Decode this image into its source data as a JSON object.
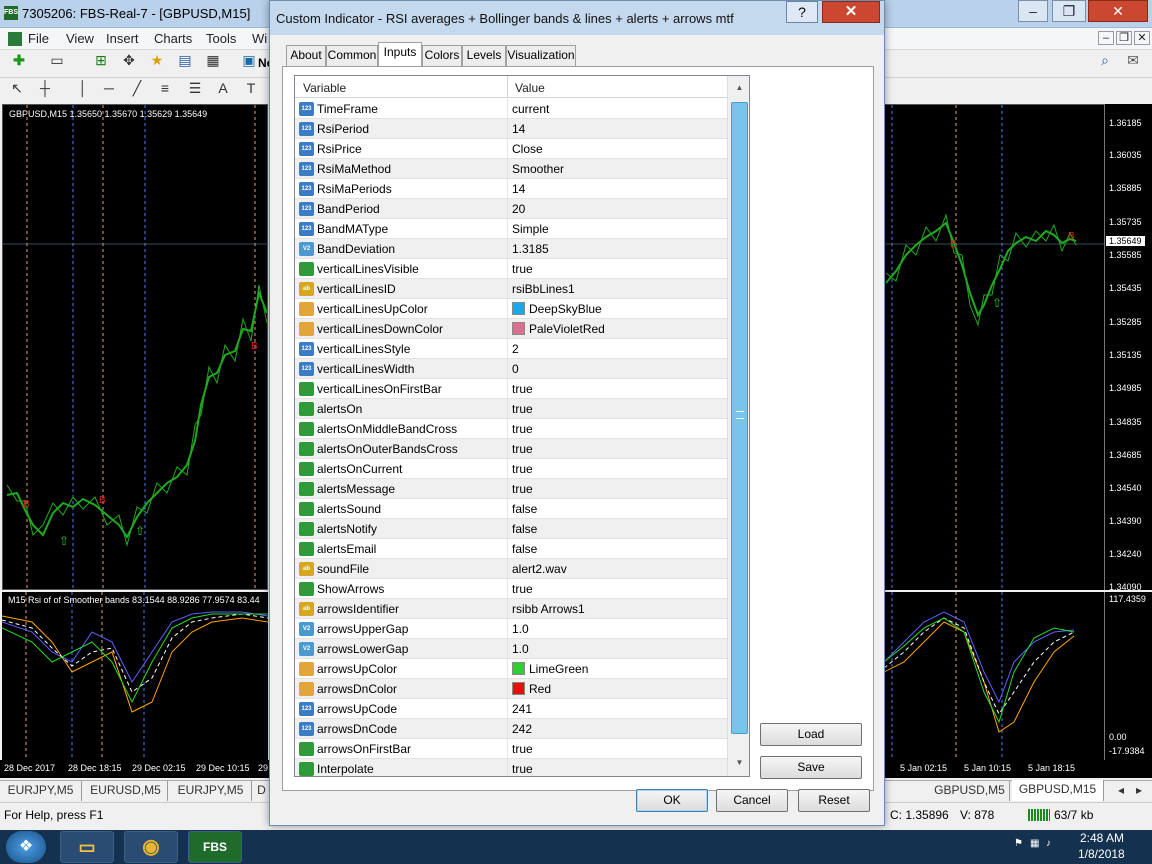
{
  "app": {
    "title": "7305206: FBS-Real-7 - [GBPUSD,M15]",
    "menu": [
      "File",
      "View",
      "Insert",
      "Charts",
      "Tools",
      "Wi"
    ],
    "toolbar_fragment": "Ne"
  },
  "chart": {
    "header": "GBPUSD,M15  1.35650 1.35670 1.35629 1.35649",
    "indicator_header": "M15 Rsi of of Smoother bands 83.1544 88.9286 77.9574 83.44",
    "price_labels": [
      "1.36185",
      "1.36035",
      "1.35885",
      "1.35735",
      "1.35649",
      "1.35585",
      "1.35435",
      "1.35285",
      "1.35135",
      "1.34985",
      "1.34835",
      "1.34685",
      "1.34540",
      "1.34390",
      "1.34240",
      "1.34090"
    ],
    "current_price": "1.35649",
    "indicator_labels": [
      "117.4359",
      "0.00",
      "-17.9384"
    ],
    "time_labels_left": [
      "28 Dec 2017",
      "28 Dec 18:15",
      "29 Dec 02:15",
      "29 Dec 10:15",
      "29"
    ],
    "time_labels_right": [
      "5 Jan 02:15",
      "5 Jan 10:15",
      "5 Jan 18:15"
    ]
  },
  "symbol_tabs": [
    "EURJPY,M5",
    "EURUSD,M5",
    "EURJPY,M5",
    "D",
    "GBPUSD,M5",
    "GBPUSD,M15"
  ],
  "active_symbol_tab": "GBPUSD,M15",
  "statusbar": {
    "help": "For Help, press F1",
    "close": "C: 1.35896",
    "volume": "V: 878",
    "traffic": "63/7 kb"
  },
  "taskbar": {
    "time": "2:48 AM",
    "date": "1/8/2018",
    "app_label": "FBS"
  },
  "dialog": {
    "title": "Custom Indicator - RSI averages + Bollinger bands & lines + alerts + arrows mtf",
    "help_glyph": "?",
    "close_glyph": "✕",
    "tabs": [
      "About",
      "Common",
      "Inputs",
      "Colors",
      "Levels",
      "Visualization"
    ],
    "active_tab": "Inputs",
    "columns": {
      "variable": "Variable",
      "value": "Value"
    },
    "params": [
      {
        "name": "TimeFrame",
        "value": "current",
        "type": "int"
      },
      {
        "name": "RsiPeriod",
        "value": "14",
        "type": "int"
      },
      {
        "name": "RsiPrice",
        "value": "Close",
        "type": "int"
      },
      {
        "name": "RsiMaMethod",
        "value": "Smoother",
        "type": "int"
      },
      {
        "name": "RsiMaPeriods",
        "value": "14",
        "type": "int"
      },
      {
        "name": "BandPeriod",
        "value": "20",
        "type": "int"
      },
      {
        "name": "BandMAType",
        "value": "Simple",
        "type": "int"
      },
      {
        "name": "BandDeviation",
        "value": "1.3185",
        "type": "double"
      },
      {
        "name": "verticalLinesVisible",
        "value": "true",
        "type": "bool"
      },
      {
        "name": "verticalLinesID",
        "value": "rsiBbLines1",
        "type": "string"
      },
      {
        "name": "verticalLinesUpColor",
        "value": "DeepSkyBlue",
        "type": "color",
        "color": "#1aa9e6"
      },
      {
        "name": "verticalLinesDownColor",
        "value": "PaleVioletRed",
        "type": "color",
        "color": "#d9708f"
      },
      {
        "name": "verticalLinesStyle",
        "value": "2",
        "type": "int"
      },
      {
        "name": "verticalLinesWidth",
        "value": "0",
        "type": "int"
      },
      {
        "name": "verticalLinesOnFirstBar",
        "value": "true",
        "type": "bool"
      },
      {
        "name": "alertsOn",
        "value": "true",
        "type": "bool"
      },
      {
        "name": "alertsOnMiddleBandCross",
        "value": "true",
        "type": "bool"
      },
      {
        "name": "alertsOnOuterBandsCross",
        "value": "true",
        "type": "bool"
      },
      {
        "name": "alertsOnCurrent",
        "value": "true",
        "type": "bool"
      },
      {
        "name": "alertsMessage",
        "value": "true",
        "type": "bool"
      },
      {
        "name": "alertsSound",
        "value": "false",
        "type": "bool"
      },
      {
        "name": "alertsNotify",
        "value": "false",
        "type": "bool"
      },
      {
        "name": "alertsEmail",
        "value": "false",
        "type": "bool"
      },
      {
        "name": "soundFile",
        "value": "alert2.wav",
        "type": "string"
      },
      {
        "name": "ShowArrows",
        "value": "true",
        "type": "bool"
      },
      {
        "name": "arrowsIdentifier",
        "value": "rsibb Arrows1",
        "type": "string"
      },
      {
        "name": "arrowsUpperGap",
        "value": "1.0",
        "type": "double"
      },
      {
        "name": "arrowsLowerGap",
        "value": "1.0",
        "type": "double"
      },
      {
        "name": "arrowsUpColor",
        "value": "LimeGreen",
        "type": "color",
        "color": "#32cd32"
      },
      {
        "name": "arrowsDnColor",
        "value": "Red",
        "type": "color",
        "color": "#e31010"
      },
      {
        "name": "arrowsUpCode",
        "value": "241",
        "type": "int"
      },
      {
        "name": "arrowsDnCode",
        "value": "242",
        "type": "int"
      },
      {
        "name": "arrowsOnFirstBar",
        "value": "true",
        "type": "bool"
      },
      {
        "name": "Interpolate",
        "value": "true",
        "type": "bool"
      }
    ],
    "type_icons": {
      "int": "123",
      "double": "V2",
      "bool": "",
      "string": "ab",
      "color": ""
    },
    "buttons": {
      "load": "Load",
      "save": "Save",
      "ok": "OK",
      "cancel": "Cancel",
      "reset": "Reset"
    }
  }
}
